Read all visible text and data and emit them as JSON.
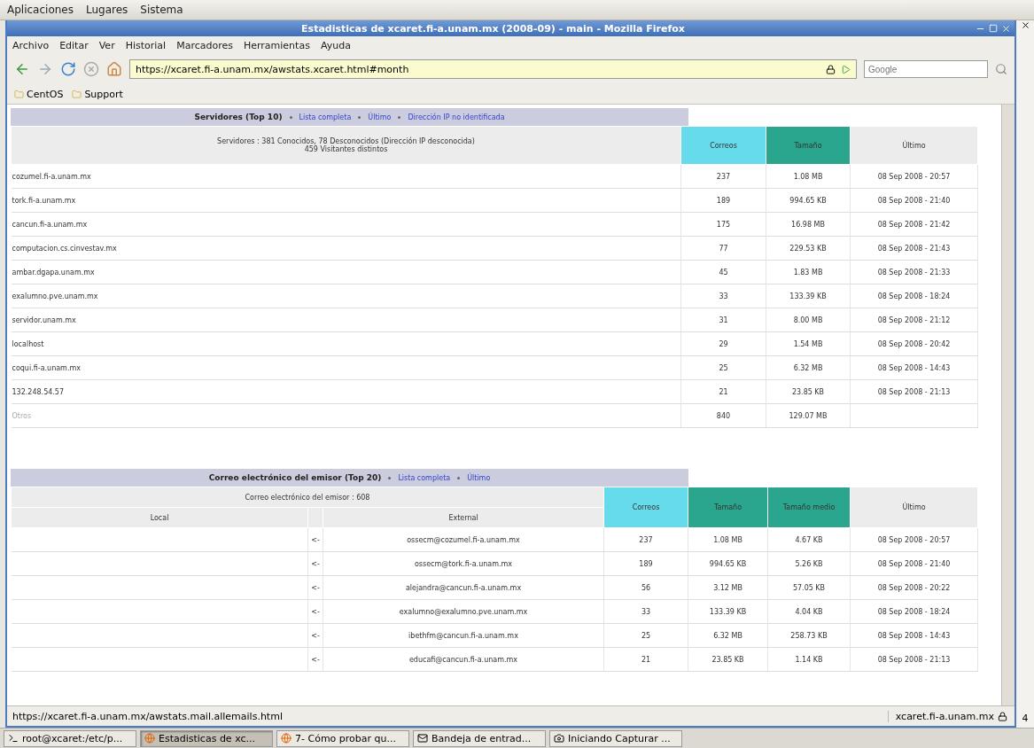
{
  "top_panel": {
    "menus": [
      "Aplicaciones",
      "Lugares",
      "Sistema"
    ]
  },
  "window": {
    "title": "Estadisticas de xcaret.fi-a.unam.mx (2008-09) - main - Mozilla Firefox"
  },
  "menu_bar": [
    "Archivo",
    "Editar",
    "Ver",
    "Historial",
    "Marcadores",
    "Herramientas",
    "Ayuda"
  ],
  "address_bar": {
    "value": "https://xcaret.fi-a.unam.mx/awstats.xcaret.html#month"
  },
  "search": {
    "placeholder": "Google"
  },
  "bookmarks": [
    "CentOS",
    "Support"
  ],
  "servers": {
    "title": "Servidores (Top 10)",
    "links": [
      "Lista completa",
      "Último",
      "Dirección IP no identificada"
    ],
    "summary": [
      "Servidores : 381 Conocidos, 78 Desconocidos (Dirección IP desconocida)",
      "459 Visitantes distintos"
    ],
    "columns": [
      {
        "label": "Correos",
        "kind": "count"
      },
      {
        "label": "Tamaño",
        "kind": "size"
      },
      {
        "label": "Último",
        "kind": "plain"
      }
    ],
    "rows": [
      {
        "kind": "host",
        "host": "cozumel.fi-a.unam.mx",
        "correos": "237",
        "tamano": "1.08 MB",
        "ultimo": "08 Sep 2008 - 20:57"
      },
      {
        "kind": "host",
        "host": "tork.fi-a.unam.mx",
        "correos": "189",
        "tamano": "994.65 KB",
        "ultimo": "08 Sep 2008 - 21:40"
      },
      {
        "kind": "host",
        "host": "cancun.fi-a.unam.mx",
        "correos": "175",
        "tamano": "16.98 MB",
        "ultimo": "08 Sep 2008 - 21:42"
      },
      {
        "kind": "host",
        "host": "computacion.cs.cinvestav.mx",
        "correos": "77",
        "tamano": "229.53 KB",
        "ultimo": "08 Sep 2008 - 21:43"
      },
      {
        "kind": "host",
        "host": "ambar.dgapa.unam.mx",
        "correos": "45",
        "tamano": "1.83 MB",
        "ultimo": "08 Sep 2008 - 21:33"
      },
      {
        "kind": "host",
        "host": "exalumno.pve.unam.mx",
        "correos": "33",
        "tamano": "133.39 KB",
        "ultimo": "08 Sep 2008 - 18:24"
      },
      {
        "kind": "host",
        "host": "servidor.unam.mx",
        "correos": "31",
        "tamano": "8.00 MB",
        "ultimo": "08 Sep 2008 - 21:12"
      },
      {
        "kind": "host",
        "host": "localhost",
        "correos": "29",
        "tamano": "1.54 MB",
        "ultimo": "08 Sep 2008 - 20:42"
      },
      {
        "kind": "host",
        "host": "coqui.fi-a.unam.mx",
        "correos": "25",
        "tamano": "6.32 MB",
        "ultimo": "08 Sep 2008 - 14:43"
      },
      {
        "kind": "host",
        "host": "132.248.54.57",
        "correos": "21",
        "tamano": "23.85 KB",
        "ultimo": "08 Sep 2008 - 21:13"
      },
      {
        "kind": "other",
        "host": "Otros",
        "correos": "840",
        "tamano": "129.07 MB"
      }
    ]
  },
  "senders": {
    "title": "Correo electrónico del emisor (Top 20)",
    "links": [
      "Lista completa",
      "Último"
    ],
    "summary": "Correo electrónico del emisor : 608",
    "local_label": "Local",
    "external_label": "External",
    "columns": [
      {
        "label": "Correos",
        "kind": "count"
      },
      {
        "label": "Tamaño",
        "kind": "size"
      },
      {
        "label": "Tamaño medio",
        "kind": "size"
      },
      {
        "label": "Último",
        "kind": "plain"
      }
    ],
    "rows": [
      {
        "arrow": "<-",
        "external": "ossecm@cozumel.fi-a.unam.mx",
        "correos": "237",
        "tamano": "1.08 MB",
        "medio": "4.67 KB",
        "ultimo": "08 Sep 2008 - 20:57"
      },
      {
        "arrow": "<-",
        "external": "ossecm@tork.fi-a.unam.mx",
        "correos": "189",
        "tamano": "994.65 KB",
        "medio": "5.26 KB",
        "ultimo": "08 Sep 2008 - 21:40"
      },
      {
        "arrow": "<-",
        "external": "alejandra@cancun.fi-a.unam.mx",
        "correos": "56",
        "tamano": "3.12 MB",
        "medio": "57.05 KB",
        "ultimo": "08 Sep 2008 - 20:22"
      },
      {
        "arrow": "<-",
        "external": "exalumno@exalumno.pve.unam.mx",
        "correos": "33",
        "tamano": "133.39 KB",
        "medio": "4.04 KB",
        "ultimo": "08 Sep 2008 - 18:24"
      },
      {
        "arrow": "<-",
        "external": "ibethfm@cancun.fi-a.unam.mx",
        "correos": "25",
        "tamano": "6.32 MB",
        "medio": "258.73 KB",
        "ultimo": "08 Sep 2008 - 14:43"
      },
      {
        "arrow": "<-",
        "external": "educafi@cancun.fi-a.unam.mx",
        "correos": "21",
        "tamano": "23.85 KB",
        "medio": "1.14 KB",
        "ultimo": "08 Sep 2008 - 21:13"
      }
    ]
  },
  "status_bar": {
    "text": "https://xcaret.fi-a.unam.mx/awstats.mail.allemails.html",
    "host": "xcaret.fi-a.unam.mx"
  },
  "side_window": {
    "label": "4"
  },
  "taskbar": [
    {
      "label": "root@xcaret:/etc/p...",
      "kind": "terminal",
      "selected": false
    },
    {
      "label": "Estadisticas de xc...",
      "kind": "firefox",
      "selected": true
    },
    {
      "label": "7- Cómo probar qu...",
      "kind": "firefox",
      "selected": false
    },
    {
      "label": "Bandeja de entrad...",
      "kind": "mail",
      "selected": false
    },
    {
      "label": "Iniciando Capturar ...",
      "kind": "camera",
      "selected": false
    }
  ]
}
